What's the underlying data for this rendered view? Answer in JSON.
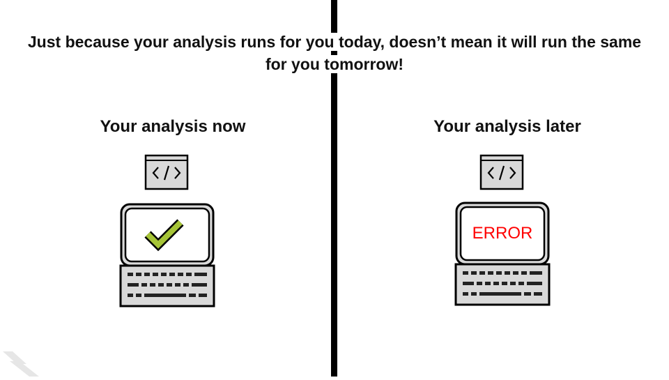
{
  "headline": {
    "line1": "Just because your analysis runs for you today, doesn’t mean it will run the same",
    "line2": "for you tomorrow!"
  },
  "left_panel": {
    "title": "Your analysis now",
    "code_icon": "code-window-icon",
    "screen_icon": "checkmark-icon",
    "check_color": "#a6c437"
  },
  "right_panel": {
    "title": "Your analysis later",
    "code_icon": "code-window-icon",
    "screen_text": "ERROR",
    "error_color": "#ff0000"
  },
  "colors": {
    "divider": "#000000",
    "icon_fill": "#d9d9d9",
    "outline": "#000000"
  }
}
